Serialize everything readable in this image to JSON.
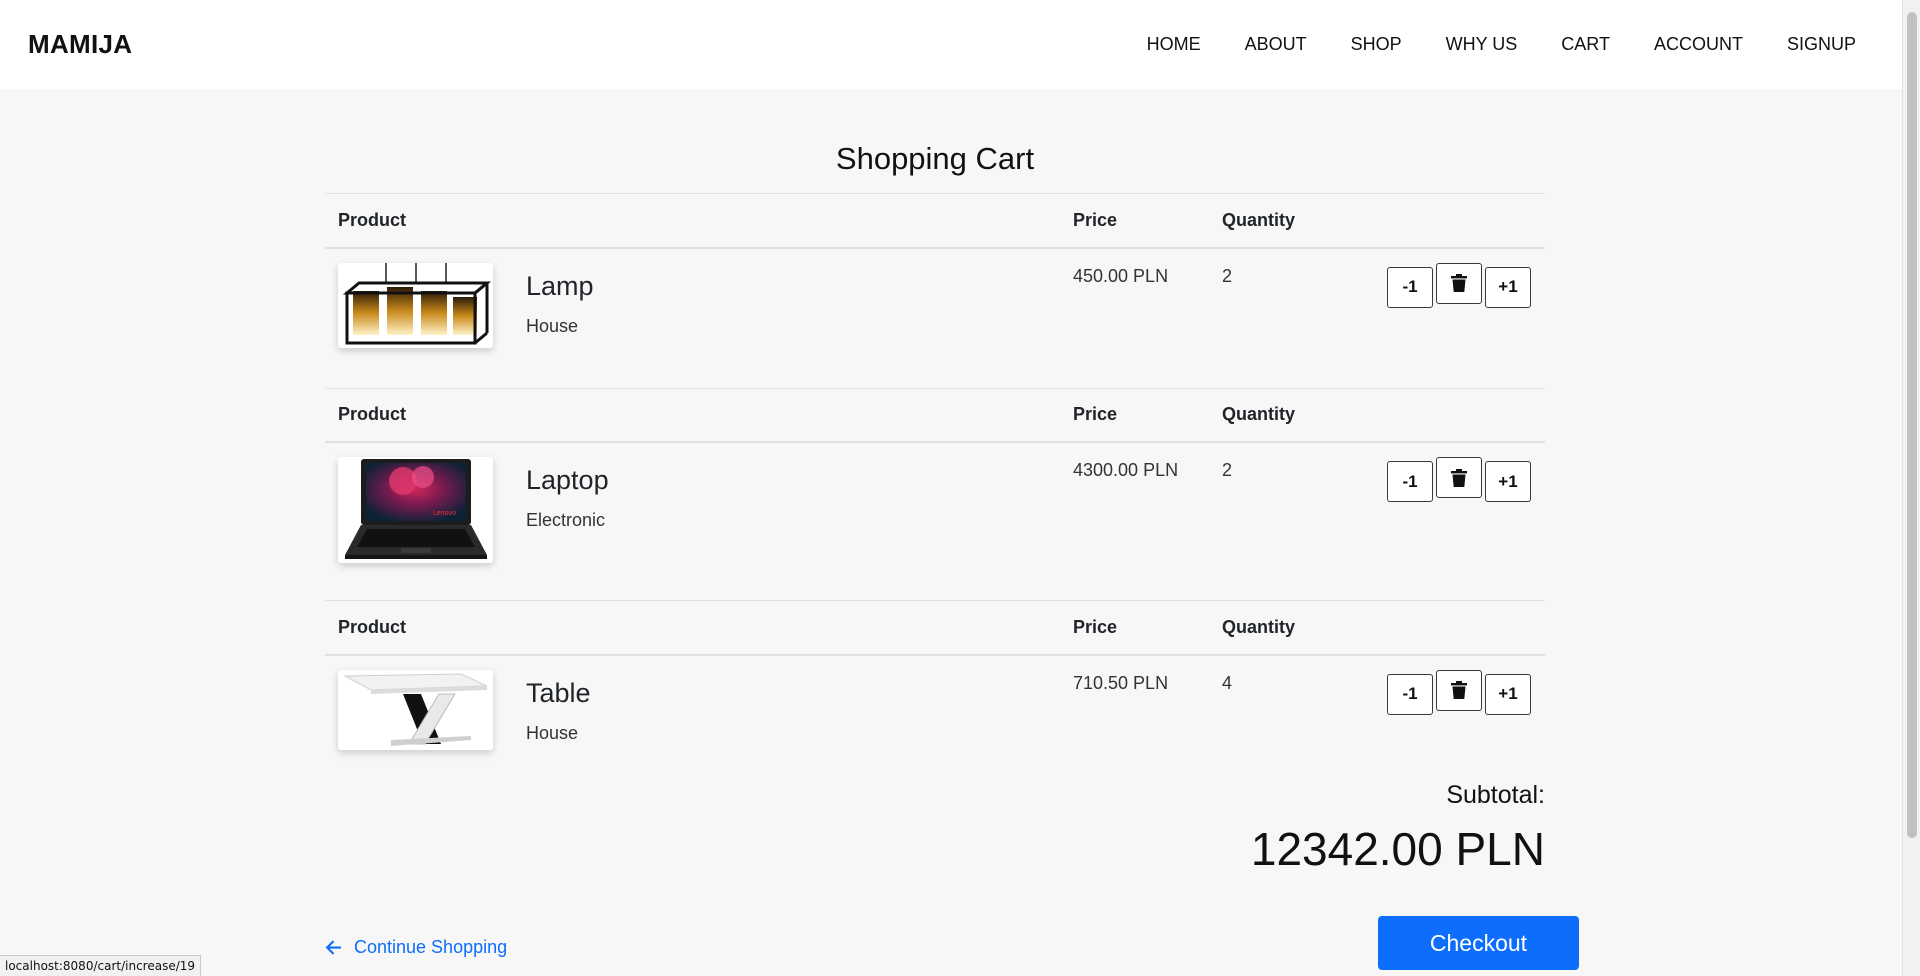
{
  "header": {
    "brand": "MAMIJA",
    "nav": [
      "HOME",
      "ABOUT",
      "SHOP",
      "WHY US",
      "CART",
      "ACCOUNT",
      "SIGNUP"
    ]
  },
  "cart": {
    "title": "Shopping Cart",
    "columns": {
      "product": "Product",
      "price": "Price",
      "quantity": "Quantity"
    },
    "buttons": {
      "decrease": "-1",
      "increase": "+1",
      "delete_icon": "trash-icon"
    },
    "items": [
      {
        "name": "Lamp",
        "category": "House",
        "price": "450.00 PLN",
        "quantity": "2",
        "image_icon": "lamp-image"
      },
      {
        "name": "Laptop",
        "category": "Electronic",
        "price": "4300.00 PLN",
        "quantity": "2",
        "image_icon": "laptop-image"
      },
      {
        "name": "Table",
        "category": "House",
        "price": "710.50 PLN",
        "quantity": "4",
        "image_icon": "table-image"
      }
    ],
    "subtotal_label": "Subtotal:",
    "subtotal_value": "12342.00 PLN"
  },
  "footer": {
    "continue_label": "Continue Shopping",
    "checkout_label": "Checkout"
  },
  "status_url": "localhost:8080/cart/increase/19",
  "colors": {
    "primary": "#0d6efd",
    "background": "#f7f7f7",
    "header_bg": "#ffffff"
  }
}
